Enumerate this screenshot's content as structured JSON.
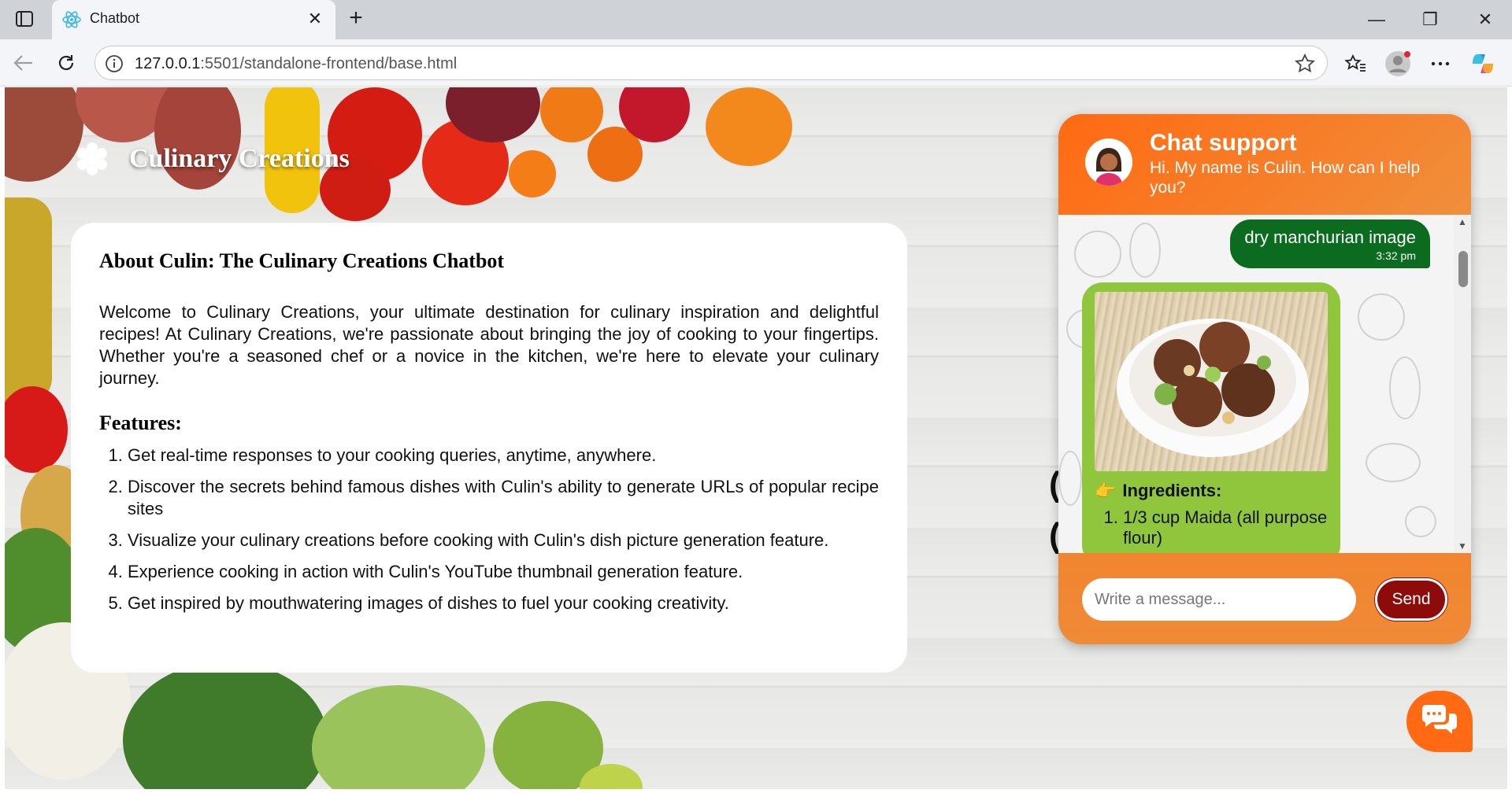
{
  "browser": {
    "tab_title": "Chatbot",
    "url_host": "127.0.0.1",
    "url_path": ":5501/standalone-frontend/base.html"
  },
  "brand": {
    "title": "Culinary Creations",
    "icon": "asterisk-icon"
  },
  "about": {
    "title": "About Culin: The Culinary Creations Chatbot",
    "text": "Welcome to Culinary Creations, your ultimate destination for culinary inspiration and delightful recipes! At Culinary Creations, we're passionate about bringing the joy of cooking to your fingertips. Whether you're a seasoned chef or a novice in the kitchen, we're here to elevate your culinary journey.",
    "features_title": "Features:",
    "features": [
      "Get real-time responses to your cooking queries, anytime, anywhere.",
      "Discover the secrets behind famous dishes with Culin's ability to generate URLs of popular recipe sites",
      "Visualize your culinary creations before cooking with Culin's dish picture generation feature.",
      "Experience cooking in action with Culin's YouTube thumbnail generation feature.",
      "Get inspired by mouthwatering images of dishes to fuel your cooking creativity."
    ]
  },
  "chat": {
    "title": "Chat support",
    "subtitle": "Hi. My name is Culin. How can I help you?",
    "outgoing": {
      "text": "dry manchurian image",
      "time": "3:32 pm"
    },
    "incoming": {
      "ingredients_label": "Ingredients:",
      "ingredients": [
        "1/3 cup Maida (all purpose flour)"
      ]
    },
    "input_placeholder": "Write a message...",
    "send_label": "Send"
  },
  "colors": {
    "accent": "#ff6a12",
    "outgoing_bubble": "#0b6b1e",
    "incoming_bubble": "#8fc63c",
    "send_button": "#8d0b0b"
  }
}
